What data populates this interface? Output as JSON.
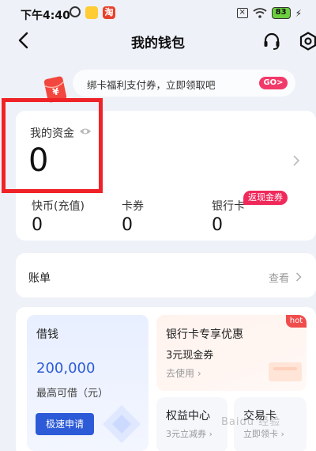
{
  "status_bar": {
    "time": "下午4:40",
    "app_badge": "淘",
    "battery": "83"
  },
  "header": {
    "title": "我的钱包"
  },
  "promo": {
    "text": "绑卡福利支付券，立即领取吧",
    "go_label": "GO>",
    "envelope_char": "¥"
  },
  "assets": {
    "label": "我的资金",
    "value": "0",
    "items": [
      {
        "label": "快币(充值)",
        "value": "0"
      },
      {
        "label": "卡券",
        "value": "0"
      },
      {
        "label": "银行卡",
        "value": "0",
        "badge": "返现金券"
      }
    ]
  },
  "bill": {
    "label": "账单",
    "view_label": "查看"
  },
  "loan": {
    "title": "借钱",
    "amount": "200,000",
    "subtitle": "最高可借（元）",
    "button": "极速申请"
  },
  "bank_offer": {
    "title": "银行卡专享优惠",
    "subtitle": "3元现金券",
    "link": "去使用",
    "badge": "hot"
  },
  "benefits": {
    "title": "权益中心",
    "subtitle": "3元立减券"
  },
  "card_center": {
    "title": "交易卡",
    "subtitle": "立即领卡"
  },
  "watermark": {
    "text": "Baidu 经验"
  },
  "colors": {
    "accent": "#2d5bd8",
    "highlight": "#ef2327",
    "badge": "#f0295b"
  }
}
